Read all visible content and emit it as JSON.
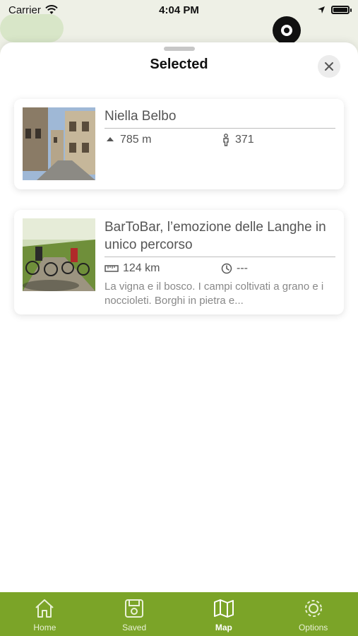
{
  "status_bar": {
    "carrier": "Carrier",
    "time": "4:04 PM"
  },
  "sheet": {
    "title": "Selected"
  },
  "cards": [
    {
      "title": "Niella Belbo",
      "meta": [
        {
          "icon": "elevation-icon",
          "value": "785 m"
        },
        {
          "icon": "population-icon",
          "value": "371"
        }
      ]
    },
    {
      "title": "BarToBar, l’emozione delle Langhe in unico percorso",
      "meta": [
        {
          "icon": "ruler-icon",
          "value": "124 km"
        },
        {
          "icon": "clock-icon",
          "value": "---"
        }
      ],
      "description": "La vigna e il bosco. I campi coltivati a grano e i noccioleti. Borghi in pietra e..."
    }
  ],
  "tab_bar": {
    "items": [
      {
        "label": "Home",
        "icon": "home-icon"
      },
      {
        "label": "Saved",
        "icon": "saved-icon"
      },
      {
        "label": "Map",
        "icon": "map-icon",
        "active": true
      },
      {
        "label": "Options",
        "icon": "gear-icon"
      }
    ]
  },
  "colors": {
    "tab_bar_bg": "#7ba428",
    "text_primary": "#555555",
    "text_secondary": "#888888"
  }
}
